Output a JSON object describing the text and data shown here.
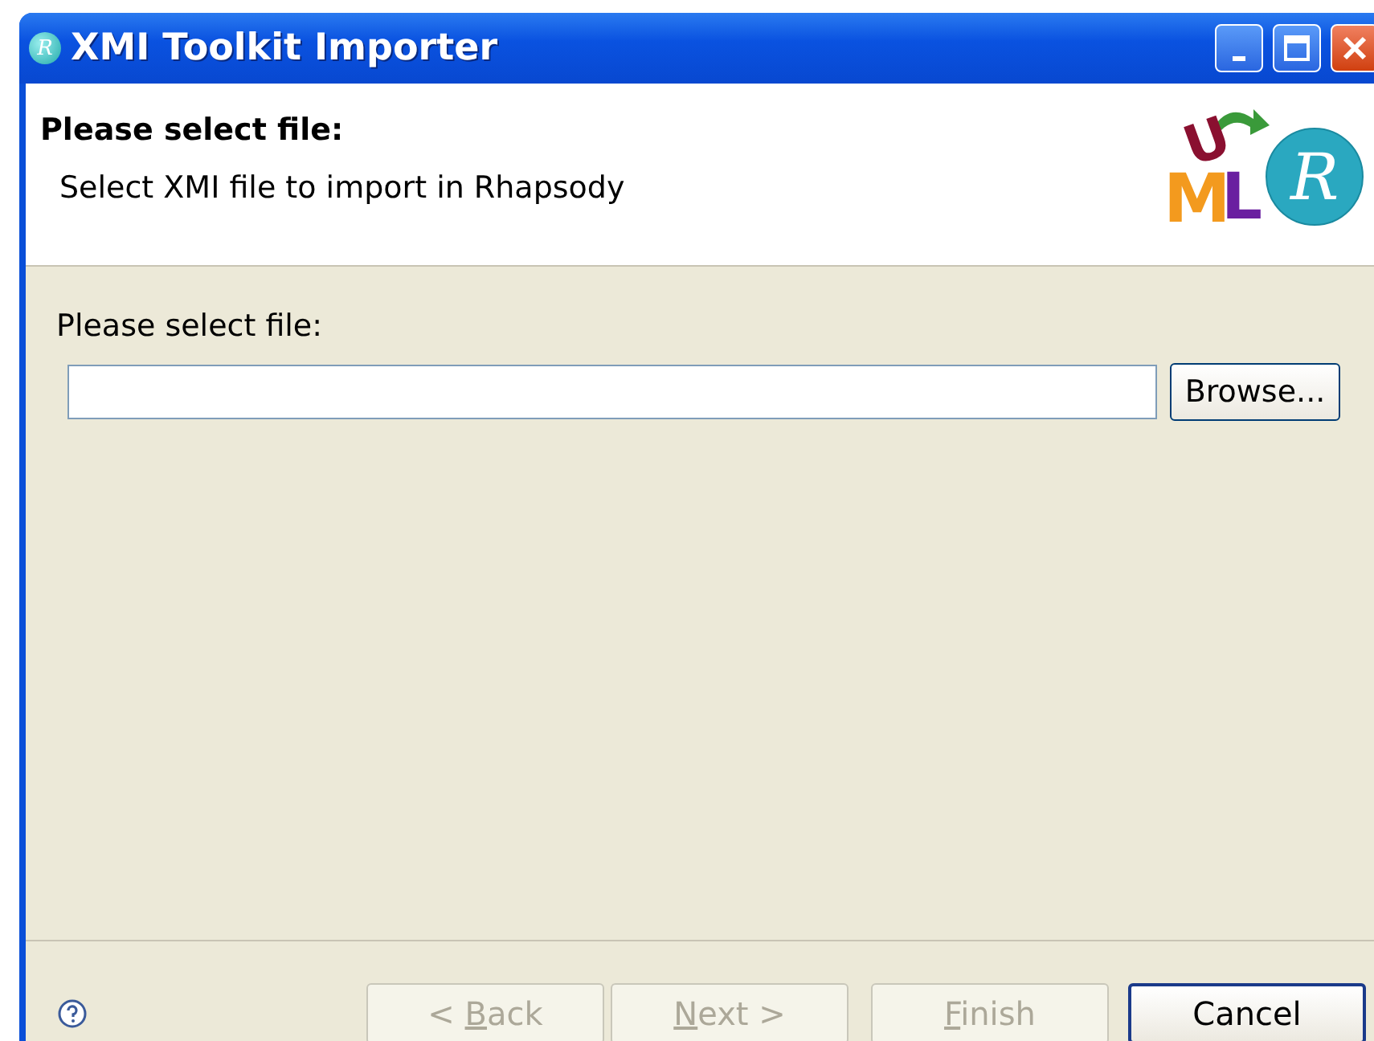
{
  "window": {
    "title": "XMI Toolkit Importer",
    "app_icon_letter": "R"
  },
  "header": {
    "title": "Please select file:",
    "description": "Select XMI file to import in Rhapsody",
    "logo": {
      "letters": [
        "M",
        "L",
        "U"
      ],
      "badge": "R"
    }
  },
  "file_field": {
    "label": "Please select file:",
    "browse_button": "Browse..."
  },
  "buttons": [
    {
      "before": "< ",
      "key": "B",
      "after": "ack",
      "disabled": true,
      "default": false
    },
    {
      "key": "N",
      "after": "ext >",
      "disabled": true,
      "default": false
    },
    {
      "key": "F",
      "after": "inish",
      "disabled": true,
      "default": false
    },
    {
      "after": "Cancel",
      "disabled": false,
      "default": true
    }
  ]
}
